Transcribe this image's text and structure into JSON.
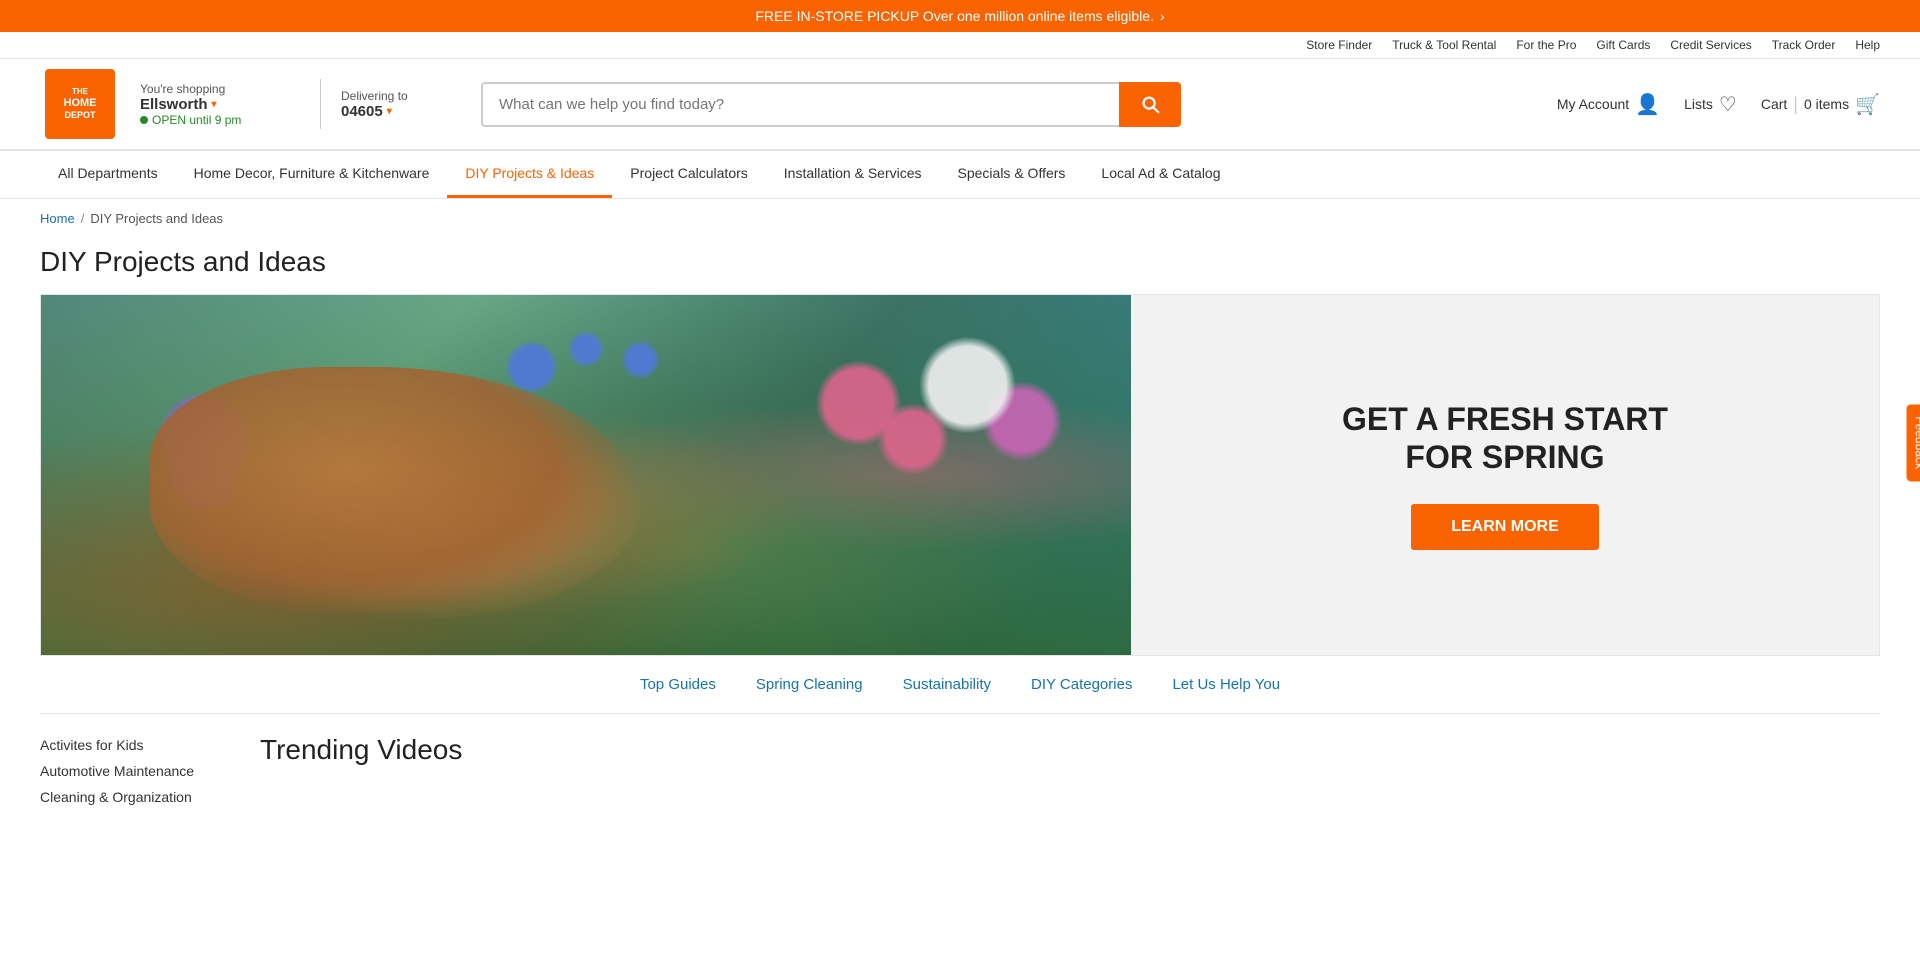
{
  "topBanner": {
    "text": "FREE IN-STORE PICKUP Over one million online items eligible.",
    "arrow": "›"
  },
  "utilityNav": {
    "links": [
      {
        "id": "store-finder",
        "label": "Store Finder"
      },
      {
        "id": "truck-tool-rental",
        "label": "Truck & Tool Rental"
      },
      {
        "id": "for-the-pro",
        "label": "For the Pro"
      },
      {
        "id": "gift-cards",
        "label": "Gift Cards"
      },
      {
        "id": "credit-services",
        "label": "Credit Services"
      },
      {
        "id": "track-order",
        "label": "Track Order"
      },
      {
        "id": "help",
        "label": "Help"
      }
    ]
  },
  "header": {
    "logo": {
      "line1": "THE",
      "line2": "HOME",
      "line3": "DEPOT"
    },
    "storeInfo": {
      "shopping": "You're shopping",
      "storeName": "Ellsworth",
      "openStatus": "OPEN until 9 pm"
    },
    "delivery": {
      "label": "Delivering to",
      "zip": "04605"
    },
    "search": {
      "placeholder": "What can we help you find today?"
    },
    "myAccount": {
      "label": "My Account"
    },
    "lists": {
      "label": "Lists"
    },
    "cart": {
      "label": "Cart",
      "separator": "|",
      "count": "0 items"
    }
  },
  "mainNav": {
    "items": [
      {
        "id": "all-departments",
        "label": "All Departments"
      },
      {
        "id": "home-decor",
        "label": "Home Decor, Furniture & Kitchenware"
      },
      {
        "id": "diy-projects",
        "label": "DIY Projects & Ideas",
        "active": true
      },
      {
        "id": "project-calculators",
        "label": "Project Calculators"
      },
      {
        "id": "installation-services",
        "label": "Installation & Services"
      },
      {
        "id": "specials-offers",
        "label": "Specials & Offers"
      },
      {
        "id": "local-ad",
        "label": "Local Ad & Catalog"
      }
    ]
  },
  "breadcrumb": {
    "home": "Home",
    "separator": "/",
    "current": "DIY Projects and Ideas"
  },
  "pageTitle": "DIY Projects and Ideas",
  "hero": {
    "ctaTitle": "GET A FRESH START\nFOR SPRING",
    "ctaButton": "Learn More"
  },
  "subNav": {
    "items": [
      {
        "id": "top-guides",
        "label": "Top Guides"
      },
      {
        "id": "spring-cleaning",
        "label": "Spring Cleaning"
      },
      {
        "id": "sustainability",
        "label": "Sustainability"
      },
      {
        "id": "diy-categories",
        "label": "DIY Categories"
      },
      {
        "id": "let-us-help",
        "label": "Let Us Help You"
      }
    ]
  },
  "sidebar": {
    "items": [
      {
        "id": "activities-kids",
        "label": "Activites for Kids"
      },
      {
        "id": "automotive",
        "label": "Automotive Maintenance"
      },
      {
        "id": "cleaning",
        "label": "Cleaning & Organization"
      }
    ]
  },
  "mainContent": {
    "trendingTitle": "Trending Videos"
  },
  "feedback": {
    "label": "Feedback"
  }
}
